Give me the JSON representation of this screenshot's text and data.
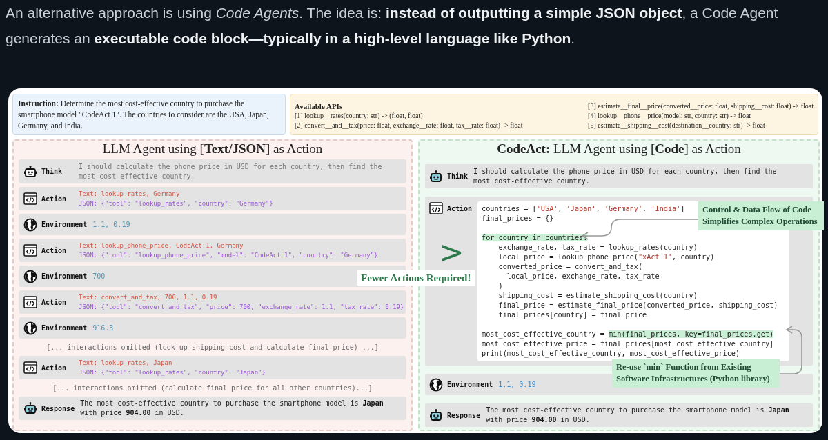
{
  "article": {
    "paragraph": "An alternative approach is using *Code Agents*. The idea is: **instead of outputting a simple JSON object**, a Code Agent generates an **executable code block—typically in a high-level language like Python**."
  },
  "figure": {
    "instruction": "**Instruction:** Determine the most cost-effective country to purchase the smartphone model \"CodeAct 1\". The countries to consider are the USA, Japan, Germany, and India.",
    "apis": {
      "columns": [
        {
          "title": "Available APIs",
          "items": [
            "[1] lookup__rates(country: str) -> (float, float)",
            "[2] convert__and__tax(price: float, exchange__rate: float, tax__rate: float) -> float"
          ]
        },
        {
          "items": [
            "[3] estimate__final__price(converted__price: float, shipping__cost: float) -> float",
            "[4] lookup__phone__price(model: str, country: str) -> float",
            "[5] estimate__shipping__cost(destination__country: str) -> float"
          ]
        }
      ]
    },
    "left_panel": {
      "title": "LLM Agent using [**Text/JSON**] as Action",
      "steps": [
        {
          "kind": "think",
          "label": "Think",
          "text": "I should calculate the phone price in USD for each country, then find the most cost-effective country."
        },
        {
          "kind": "action",
          "label": "Action",
          "text": "Text: lookup_rates, Germany",
          "json": "JSON: {\"tool\": \"lookup_rates\", \"country\": \"Germany\"}"
        },
        {
          "kind": "environment",
          "label": "Environment",
          "text": "1.1, 0.19"
        },
        {
          "kind": "action",
          "label": "Action",
          "text": "Text: lookup_phone_price, CodeAct 1, Germany",
          "json": "JSON: {\"tool\": \"lookup_phone_price\", \"model\": \"CodeAct 1\", \"country\": \"Germany\"}"
        },
        {
          "kind": "environment",
          "label": "Environment",
          "text": "700"
        },
        {
          "kind": "action",
          "label": "Action",
          "text": "Text: convert_and_tax, 700, 1.1, 0.19",
          "json": "JSON: {\"tool\": \"convert_and_tax\", \"price\": 700, \"exchange_rate\": 1.1, \"tax_rate\": 0.19}"
        },
        {
          "kind": "environment",
          "label": "Environment",
          "text": "916.3"
        },
        {
          "kind": "omitted",
          "text": "[... interactions omitted (look up shipping cost and calculate final price) ...]"
        },
        {
          "kind": "action",
          "label": "Action",
          "text": "Text: lookup_rates, Japan",
          "json": "JSON: {\"tool\": \"lookup_rates\", \"country\": \"Japan\"}"
        },
        {
          "kind": "omitted",
          "text": "[... interactions omitted (calculate final price for all other countries)...]"
        },
        {
          "kind": "response",
          "label": "Response",
          "text": "The most cost-effective country to purchase the smartphone model is **Japan** with price **904.00** in USD."
        }
      ]
    },
    "comparison": {
      "symbol": ">",
      "label": "Fewer Actions Required!"
    },
    "right_panel": {
      "title": "**CodeAct:** LLM Agent using [**Code**] as Action",
      "steps": [
        {
          "kind": "think",
          "label": "Think",
          "text": "I should calculate the phone price in USD for each country, then find the most cost-effective country."
        },
        {
          "kind": "code",
          "label": "Action",
          "blocks": [
            [
              [
                {
                  "text": "countries = [",
                  "kind": "plain"
                },
                {
                  "text": "'USA'",
                  "kind": "string"
                },
                {
                  "text": ", ",
                  "kind": "plain"
                },
                {
                  "text": "'Japan'",
                  "kind": "string"
                },
                {
                  "text": ", ",
                  "kind": "plain"
                },
                {
                  "text": "'Germany'",
                  "kind": "string"
                },
                {
                  "text": ", ",
                  "kind": "plain"
                },
                {
                  "text": "'India'",
                  "kind": "string"
                },
                {
                  "text": "]",
                  "kind": "plain"
                }
              ],
              "final_prices = {}"
            ],
            [
              [
                {
                  "text": "for country in countries:",
                  "kind": "highlight"
                }
              ],
              "    exchange_rate, tax_rate = lookup_rates(country)",
              [
                {
                  "text": "    local_price = lookup_phone_price(",
                  "kind": "plain"
                },
                {
                  "text": "\"xAct 1\"",
                  "kind": "string"
                },
                {
                  "text": ", country)",
                  "kind": "plain"
                }
              ],
              "    converted_price = convert_and_tax(",
              "      local_price, exchange_rate, tax_rate",
              "    )",
              "    shipping_cost = estimate_shipping_cost(country)",
              "    final_price = estimate_final_price(converted_price, shipping_cost)",
              "    final_prices[country] = final_price"
            ],
            [
              [
                {
                  "text": "most_cost_effective_country = ",
                  "kind": "plain"
                },
                {
                  "text": "min(final_prices, key=final_prices.get)",
                  "kind": "highlight"
                }
              ],
              "most_cost_effective_price = final_prices[most_cost_effective_country]",
              "print(most_cost_effective_country, most_cost_effective_price)"
            ]
          ]
        },
        {
          "kind": "environment",
          "label": "Environment",
          "text": "1.1, 0.19"
        },
        {
          "kind": "response",
          "label": "Response",
          "text": "The most cost-effective country to purchase the smartphone model is **Japan** with price **904.00** in USD."
        }
      ]
    },
    "callouts": [
      {
        "text": "Control & Data Flow of Code Simplifies Complex Operations"
      },
      {
        "text": "Re-use `min` Function from Existing Software Infrastructures (Python library)"
      }
    ]
  }
}
